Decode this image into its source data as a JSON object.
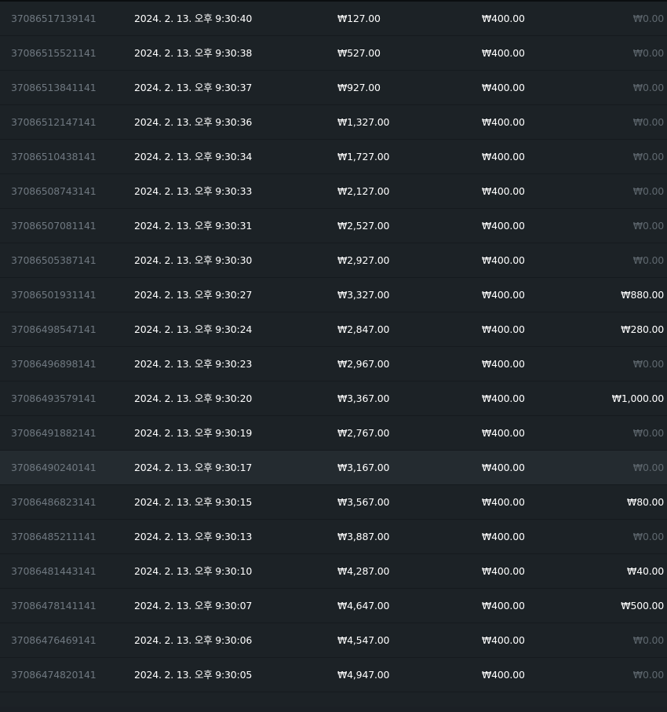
{
  "rows": [
    {
      "id": "37086517139141",
      "time": "2024. 2. 13. 오후 9:30:40",
      "amount": "₩127.00",
      "bet": "₩400.00",
      "win": "₩0.00",
      "zero": true
    },
    {
      "id": "37086515521141",
      "time": "2024. 2. 13. 오후 9:30:38",
      "amount": "₩527.00",
      "bet": "₩400.00",
      "win": "₩0.00",
      "zero": true
    },
    {
      "id": "37086513841141",
      "time": "2024. 2. 13. 오후 9:30:37",
      "amount": "₩927.00",
      "bet": "₩400.00",
      "win": "₩0.00",
      "zero": true
    },
    {
      "id": "37086512147141",
      "time": "2024. 2. 13. 오후 9:30:36",
      "amount": "₩1,327.00",
      "bet": "₩400.00",
      "win": "₩0.00",
      "zero": true
    },
    {
      "id": "37086510438141",
      "time": "2024. 2. 13. 오후 9:30:34",
      "amount": "₩1,727.00",
      "bet": "₩400.00",
      "win": "₩0.00",
      "zero": true
    },
    {
      "id": "37086508743141",
      "time": "2024. 2. 13. 오후 9:30:33",
      "amount": "₩2,127.00",
      "bet": "₩400.00",
      "win": "₩0.00",
      "zero": true
    },
    {
      "id": "37086507081141",
      "time": "2024. 2. 13. 오후 9:30:31",
      "amount": "₩2,527.00",
      "bet": "₩400.00",
      "win": "₩0.00",
      "zero": true
    },
    {
      "id": "37086505387141",
      "time": "2024. 2. 13. 오후 9:30:30",
      "amount": "₩2,927.00",
      "bet": "₩400.00",
      "win": "₩0.00",
      "zero": true
    },
    {
      "id": "37086501931141",
      "time": "2024. 2. 13. 오후 9:30:27",
      "amount": "₩3,327.00",
      "bet": "₩400.00",
      "win": "₩880.00",
      "zero": false
    },
    {
      "id": "37086498547141",
      "time": "2024. 2. 13. 오후 9:30:24",
      "amount": "₩2,847.00",
      "bet": "₩400.00",
      "win": "₩280.00",
      "zero": false
    },
    {
      "id": "37086496898141",
      "time": "2024. 2. 13. 오후 9:30:23",
      "amount": "₩2,967.00",
      "bet": "₩400.00",
      "win": "₩0.00",
      "zero": true
    },
    {
      "id": "37086493579141",
      "time": "2024. 2. 13. 오후 9:30:20",
      "amount": "₩3,367.00",
      "bet": "₩400.00",
      "win": "₩1,000.00",
      "zero": false
    },
    {
      "id": "37086491882141",
      "time": "2024. 2. 13. 오후 9:30:19",
      "amount": "₩2,767.00",
      "bet": "₩400.00",
      "win": "₩0.00",
      "zero": true
    },
    {
      "id": "37086490240141",
      "time": "2024. 2. 13. 오후 9:30:17",
      "amount": "₩3,167.00",
      "bet": "₩400.00",
      "win": "₩0.00",
      "zero": true,
      "highlighted": true
    },
    {
      "id": "37086486823141",
      "time": "2024. 2. 13. 오후 9:30:15",
      "amount": "₩3,567.00",
      "bet": "₩400.00",
      "win": "₩80.00",
      "zero": false
    },
    {
      "id": "37086485211141",
      "time": "2024. 2. 13. 오후 9:30:13",
      "amount": "₩3,887.00",
      "bet": "₩400.00",
      "win": "₩0.00",
      "zero": true
    },
    {
      "id": "37086481443141",
      "time": "2024. 2. 13. 오후 9:30:10",
      "amount": "₩4,287.00",
      "bet": "₩400.00",
      "win": "₩40.00",
      "zero": false
    },
    {
      "id": "37086478141141",
      "time": "2024. 2. 13. 오후 9:30:07",
      "amount": "₩4,647.00",
      "bet": "₩400.00",
      "win": "₩500.00",
      "zero": false
    },
    {
      "id": "37086476469141",
      "time": "2024. 2. 13. 오후 9:30:06",
      "amount": "₩4,547.00",
      "bet": "₩400.00",
      "win": "₩0.00",
      "zero": true
    },
    {
      "id": "37086474820141",
      "time": "2024. 2. 13. 오후 9:30:05",
      "amount": "₩4,947.00",
      "bet": "₩400.00",
      "win": "₩0.00",
      "zero": true
    }
  ]
}
